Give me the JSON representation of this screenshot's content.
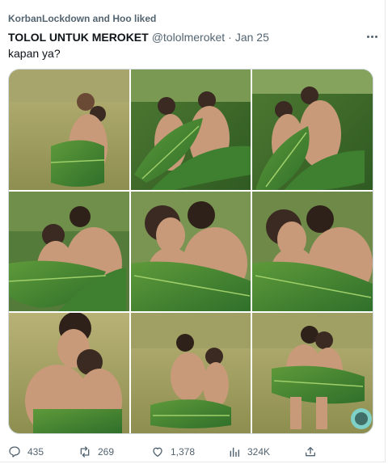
{
  "social_context": "KorbanLockdown and Hoo liked",
  "tweet": {
    "display_name": "TOLOL UNTUK MEROKET",
    "handle": "@tololmeroket",
    "separator": "·",
    "date": "Jan 25",
    "text": "kapan ya?"
  },
  "media": {
    "alt": "Photo collage of a couple posing behind large banana leaves",
    "grid_rows": 3,
    "grid_cols": 3,
    "tile_count": 9
  },
  "actions": {
    "replies": "435",
    "retweets": "269",
    "likes": "1,378",
    "views": "324K"
  },
  "icons": {
    "more": "more-horizontal-icon",
    "reply": "reply-icon",
    "retweet": "retweet-icon",
    "like": "heart-icon",
    "views": "views-chart-icon",
    "share": "share-icon"
  },
  "colors": {
    "text": "#0f1419",
    "secondary": "#536471",
    "border": "#cfd9de"
  }
}
